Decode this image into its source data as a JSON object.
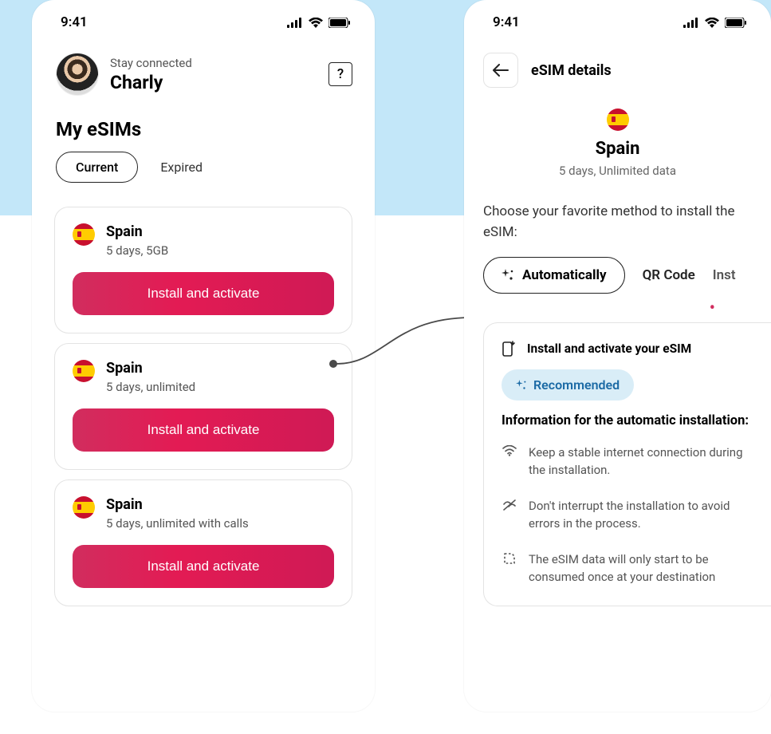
{
  "status": {
    "time": "9:41"
  },
  "left": {
    "greeting_small": "Stay connected",
    "user_name": "Charly",
    "help_label": "?",
    "section_title": "My eSIMs",
    "tab_current": "Current",
    "tab_expired": "Expired",
    "cards": [
      {
        "country": "Spain",
        "plan": "5 days, 5GB",
        "cta": "Install and activate"
      },
      {
        "country": "Spain",
        "plan": "5 days, unlimited",
        "cta": "Install and activate"
      },
      {
        "country": "Spain",
        "plan": "5 days, unlimited with calls",
        "cta": "Install and activate"
      }
    ]
  },
  "right": {
    "page_title": "eSIM details",
    "country": "Spain",
    "plan": "5 days, Unlimited data",
    "choose_text": "Choose your favorite method to install the eSIM:",
    "methods": {
      "auto": "Automatically",
      "qr": "QR Code",
      "install": "Inst"
    },
    "info": {
      "title": "Install and activate your eSIM",
      "recommended": "Recommended",
      "heading": "Information for the automatic installation:",
      "bullets": [
        "Keep a stable internet connection during the installation.",
        "Don't interrupt the installation to avoid errors in the process.",
        "The eSIM data will only start to be consumed once at your destination"
      ]
    }
  }
}
